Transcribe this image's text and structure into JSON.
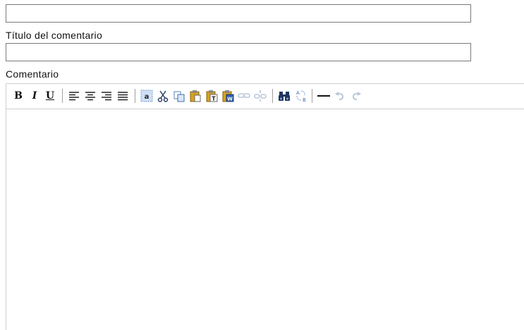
{
  "form": {
    "first_field_value": "",
    "title_label": "Título del comentario",
    "title_value": "",
    "comment_label": "Comentario",
    "comment_text": ""
  },
  "toolbar": {
    "bold_glyph": "B",
    "italic_glyph": "I",
    "underline_glyph": "U",
    "buttons": [
      {
        "name": "bold-button",
        "icon": "bold-icon"
      },
      {
        "name": "italic-button",
        "icon": "italic-icon"
      },
      {
        "name": "underline-button",
        "icon": "underline-icon"
      },
      {
        "name": "align-left-button",
        "icon": "align-left-icon"
      },
      {
        "name": "align-center-button",
        "icon": "align-center-icon"
      },
      {
        "name": "align-right-button",
        "icon": "align-right-icon"
      },
      {
        "name": "align-justify-button",
        "icon": "align-justify-icon"
      },
      {
        "name": "select-all-button",
        "icon": "select-all-icon"
      },
      {
        "name": "cut-button",
        "icon": "scissors-icon"
      },
      {
        "name": "copy-button",
        "icon": "copy-icon"
      },
      {
        "name": "paste-button",
        "icon": "paste-icon"
      },
      {
        "name": "paste-text-button",
        "icon": "paste-text-icon"
      },
      {
        "name": "paste-word-button",
        "icon": "paste-word-icon"
      },
      {
        "name": "link-button",
        "icon": "link-icon",
        "disabled": true
      },
      {
        "name": "unlink-button",
        "icon": "unlink-icon",
        "disabled": true
      },
      {
        "name": "find-button",
        "icon": "binoculars-icon"
      },
      {
        "name": "replace-button",
        "icon": "replace-icon"
      },
      {
        "name": "horizontal-rule-button",
        "icon": "horizontal-rule-icon"
      },
      {
        "name": "undo-button",
        "icon": "undo-icon",
        "disabled": true
      },
      {
        "name": "redo-button",
        "icon": "redo-icon",
        "disabled": true
      }
    ]
  },
  "colors": {
    "border": "#7a7a7a",
    "editor_border": "#cfcfcf",
    "icon_dark": "#222222",
    "icon_blue": "#3a6fb0",
    "icon_gold": "#d9a21b",
    "icon_disabled": "#b9c7d8"
  }
}
